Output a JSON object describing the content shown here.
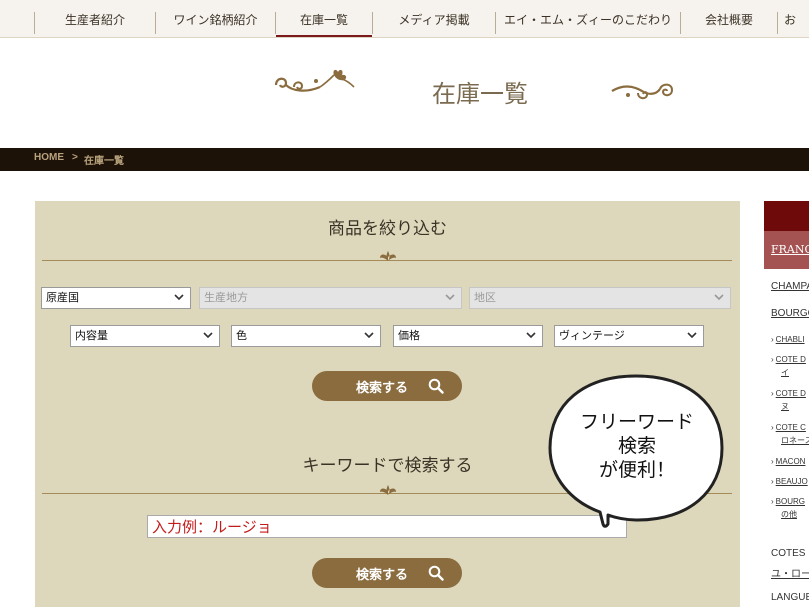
{
  "nav": {
    "items": [
      "生産者紹介",
      "ワイン銘柄紹介",
      "在庫一覧",
      "メディア掲載",
      "エイ・エム・ズィーのこだわり",
      "会社概要",
      "お"
    ],
    "active_index": 2
  },
  "page": {
    "title": "在庫一覧"
  },
  "breadcrumb": {
    "home": "HOME",
    "separator": ">",
    "current": "在庫一覧"
  },
  "filter": {
    "heading": "商品を絞り込む",
    "country": "原産国",
    "region": "生産地方",
    "district": "地区",
    "volume": "内容量",
    "color": "色",
    "price": "価格",
    "vintage": "ヴィンテージ",
    "search_label": "検索する"
  },
  "keyword": {
    "heading": "キーワードで検索する",
    "placeholder": "入力例：ルージョ",
    "search_label": "検索する"
  },
  "bubble": {
    "line1": "フリーワード",
    "line2": "検索",
    "line3": "が便利！"
  },
  "sidebar": {
    "header": "FRANC",
    "links": [
      "CHAMPA",
      "BOURGO",
      "COTES",
      "ユ・ロー",
      "LANGUE"
    ],
    "sub": [
      "CHABLI",
      "COTE D",
      "イ",
      "COTE D",
      "ヌ",
      "COTE C",
      "ロネース",
      "MACON",
      "BEAUJO",
      "BOURG",
      "の他"
    ]
  },
  "colors": {
    "accent": "#8a6c3f",
    "panel": "#ddd8bb",
    "breadcrumb_bg": "#1c1208",
    "wine": "#6f0a0a"
  }
}
